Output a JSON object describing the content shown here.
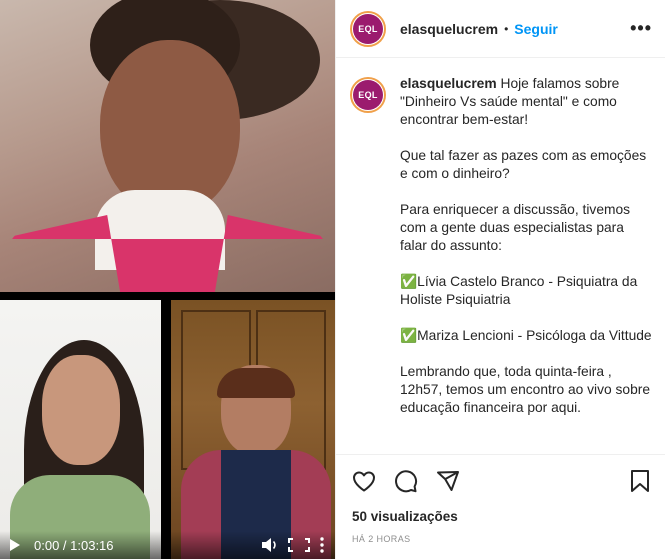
{
  "post": {
    "username": "elasquelucrem",
    "separator": "•",
    "follow_label": "Seguir",
    "more_label": "•••",
    "avatar_text": "EQL",
    "caption_user": "elasquelucrem",
    "caption_text": " Hoje falamos sobre \"Dinheiro Vs saúde mental\" e como encontrar bem-estar!\n\nQue tal fazer as pazes com as emoções e com o dinheiro?\n\nPara enriquecer a discussão, tivemos com a gente duas especialistas para falar do assunto:\n\n✅Lívia Castelo Branco - Psiquiatra da Holiste Psiquiatria\n\n✅Mariza Lencioni - Psicóloga da Vittude\n\nLembrando que, toda quinta-feira , 12h57, temos um encontro ao vivo sobre educação financeira por aqui.",
    "views": "50 visualizações",
    "time_ago": "HÁ 2 HORAS"
  },
  "player": {
    "time": "0:00 / 1:03:16",
    "icons": [
      "play-icon",
      "volume-icon",
      "fullscreen-icon",
      "more-vertical-icon"
    ]
  },
  "actions": {
    "icons": [
      "heart-icon",
      "comment-icon",
      "share-icon",
      "bookmark-icon"
    ]
  },
  "colors": {
    "brand": "#9b1b6e",
    "follow": "#0095f6",
    "ring": "#f0a04a"
  }
}
